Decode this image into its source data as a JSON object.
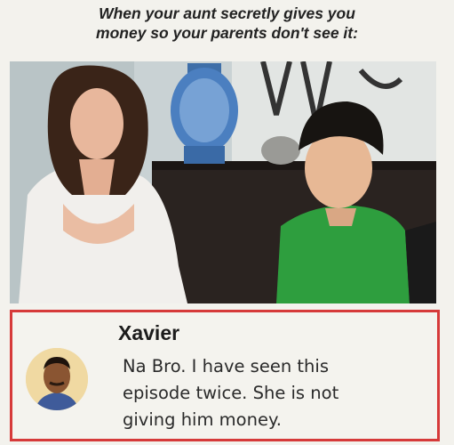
{
  "meme": {
    "caption_lines": [
      "When your aunt secretly gives you",
      "money so your parents don't see it:"
    ]
  },
  "comment": {
    "author": "Xavier",
    "text_lines": [
      "Na Bro. I have seen this",
      "episode twice. She is not",
      "giving him money."
    ]
  },
  "colors": {
    "comment_border": "#d63a3a",
    "shirt_green": "#2e9e3e"
  }
}
